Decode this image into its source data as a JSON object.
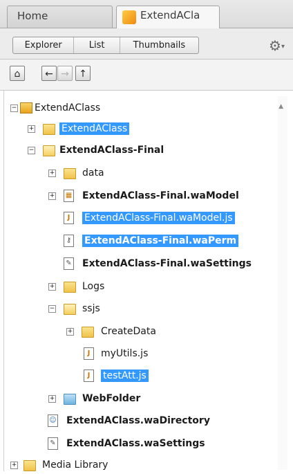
{
  "tabs": {
    "home": "Home",
    "active": "ExtendACla"
  },
  "view_buttons": {
    "explorer": "Explorer",
    "list": "List",
    "thumbnails": "Thumbnails"
  },
  "nav": {
    "home": "⌂",
    "back": "←",
    "forward": "→",
    "up": "↑"
  },
  "tree": {
    "root": "ExtendAClass",
    "n1": "ExtendAClass",
    "n2": "ExtendAClass-Final",
    "data": "data",
    "model": "ExtendAClass-Final.waModel",
    "modeljs": "ExtendAClass-Final.waModel.js",
    "perm": "ExtendAClass-Final.waPerm",
    "settings": "ExtendAClass-Final.waSettings",
    "logs": "Logs",
    "ssjs": "ssjs",
    "createdata": "CreateData",
    "myutils": "myUtils.js",
    "testatt": "testAtt.js",
    "webfolder": "WebFolder",
    "directory": "ExtendAClass.waDirectory",
    "rootsettings": "ExtendAClass.waSettings",
    "media": "Media Library"
  }
}
